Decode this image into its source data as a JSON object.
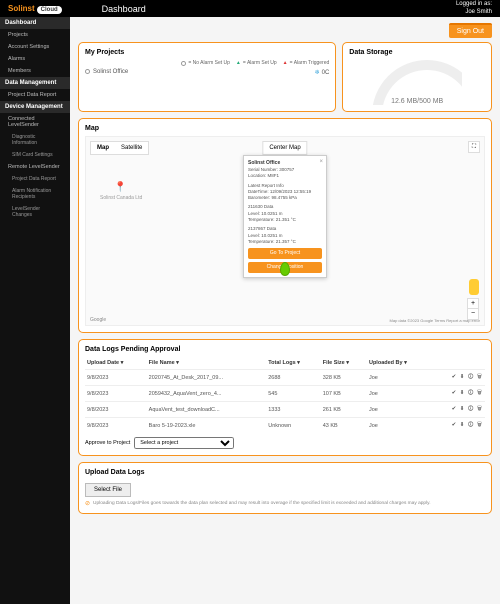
{
  "brand": {
    "part1": "Solinst",
    "part2": "Cloud"
  },
  "pageTitle": "Dashboard",
  "loginLine1": "Logged in as:",
  "loginLine2": "Joe Smith",
  "signOut": "Sign Out",
  "sidebar": {
    "groups": [
      {
        "title": "Dashboard",
        "items": [
          "Projects",
          "Account Settings",
          "Alarms",
          "Members"
        ]
      },
      {
        "title": "Data Management",
        "items": [
          "Project Data Report"
        ]
      },
      {
        "title": "Device Management",
        "items": [],
        "nested": [
          {
            "label": "Connected LevelSender",
            "subs": [
              "Diagnostic Information",
              "SIM Card Settings"
            ]
          },
          {
            "label": "Remote LevelSender",
            "subs": [
              "Project Data Report",
              "Alarm Notification Recipients",
              "LevelSender Changes"
            ]
          }
        ]
      }
    ]
  },
  "projects": {
    "title": "My Projects",
    "legend": {
      "none": "= No Alarm Set Up",
      "set": "= Alarm Set Up",
      "trig": "= Alarm Triggered"
    },
    "row": {
      "name": "Solinst Office",
      "temp": "0C"
    }
  },
  "storage": {
    "title": "Data Storage",
    "text": "12.6 MB/500 MB"
  },
  "map": {
    "title": "Map",
    "tabs": {
      "map": "Map",
      "sat": "Satellite"
    },
    "center": "Center Map",
    "pinLabel": "Solinst Canada Ltd",
    "info": {
      "title": "Solinst Office",
      "serial": "Serial Number: 300757",
      "loc": "Location: M8F1",
      "latest": "Latest Report Info",
      "datetime": "DateTime: 12/09/2023 12:55:19",
      "baro": "Barometer: 98.4755 kPa",
      "d1": "211630 Data",
      "lvl": "Level: 10.0251 m",
      "tmp": "Temperature: 21.351 °C",
      "d2": "2137867 Data",
      "lvl2": "Level: 10.0251 m",
      "tmp2": "Temperature: 21.357 °C",
      "goto": "Go To Project",
      "change": "Change Position"
    },
    "google": "Google",
    "footer": "Map data ©2023 Google   Terms   Report a map error"
  },
  "pending": {
    "title": "Data Logs Pending Approval",
    "headers": [
      "Upload Date ▾",
      "File Name ▾",
      "Total Logs ▾",
      "File Size ▾",
      "Uploaded By ▾",
      ""
    ],
    "rows": [
      {
        "date": "9/8/2023",
        "file": "2020745_At_Desk_2017_09...",
        "logs": "2688",
        "size": "328 KB",
        "by": "Joe"
      },
      {
        "date": "9/8/2023",
        "file": "2059432_AquaVent_zero_4...",
        "logs": "545",
        "size": "107 KB",
        "by": "Joe"
      },
      {
        "date": "9/8/2023",
        "file": "AquaVent_test_downloadC...",
        "logs": "1333",
        "size": "261 KB",
        "by": "Joe"
      },
      {
        "date": "9/8/2023",
        "file": "Baro 5-19-2023.xle",
        "logs": "Unknown",
        "size": "43 KB",
        "by": "Joe"
      }
    ],
    "approveLabel": "Approve to Project",
    "approveDefault": "Select a project"
  },
  "upload": {
    "title": "Upload Data Logs",
    "select": "Select File",
    "warning": "Uploading Data Logs/Files goes towards the data plan selected and may result into overage if the specified limit is exceeded and additional charges may apply."
  }
}
